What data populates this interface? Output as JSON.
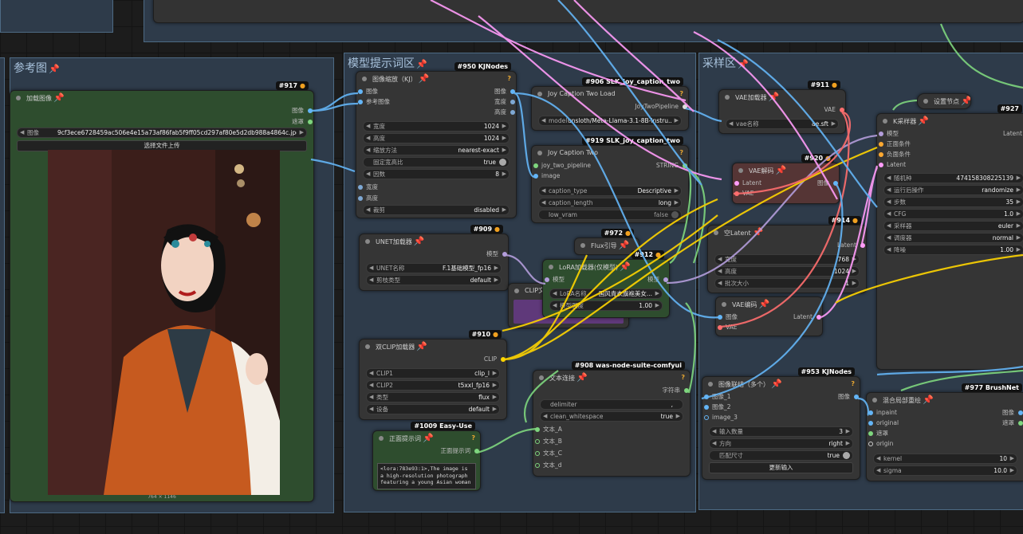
{
  "groups": {
    "reference": {
      "title": "参考图"
    },
    "prompt": {
      "title": "模型提示词区"
    },
    "sampler": {
      "title": "采样区"
    }
  },
  "nodes": {
    "load_image": {
      "badge": "#917",
      "title": "加载图像",
      "outputs": [
        "图像",
        "遮罩"
      ],
      "image_name_label": "图像",
      "image_name_value": "9cf3ece6728459ac506e4e15a73af86fab5f9ff05cd297af80e5d2db988a4864c.jpg",
      "upload_label": "选择文件上传",
      "image_size": "764 × 1146"
    },
    "image_scale": {
      "badge": "#950 KJNodes",
      "title": "图像缩放（KJ）",
      "inputs": [
        "图像",
        "参考图像"
      ],
      "outputs": [
        "图像",
        "宽度",
        "高度"
      ],
      "widgets": [
        {
          "label": "宽度",
          "value": "1024"
        },
        {
          "label": "高度",
          "value": "1024"
        },
        {
          "label": "缩放方法",
          "value": "nearest-exact"
        },
        {
          "label": "固定宽高比",
          "value": "true"
        },
        {
          "label": "因数",
          "value": "8"
        }
      ],
      "extra_inputs": [
        "宽度",
        "高度"
      ],
      "crop": {
        "label": "裁剪",
        "value": "disabled"
      }
    },
    "joy_load": {
      "badge": "#906 SLK_joy_caption_two",
      "title": "Joy Caption Two Load",
      "output": "JoyTwoPipeline",
      "model": {
        "label": "model",
        "value": "unsloth/Meta-Llama-3.1-8B-Instru..."
      }
    },
    "joy_two": {
      "badge": "#919 SLK_joy_caption_two",
      "title": "Joy Caption Two",
      "inputs": [
        "joy_two_pipeline",
        "image"
      ],
      "output": "STRING",
      "widgets": [
        {
          "label": "caption_type",
          "value": "Descriptive"
        },
        {
          "label": "caption_length",
          "value": "long"
        },
        {
          "label": "low_vram",
          "value": "false"
        }
      ]
    },
    "unet": {
      "badge": "#909",
      "title": "UNET加载器",
      "output": "模型",
      "widgets": [
        {
          "label": "UNET名称",
          "value": "F.1基础模型_fp16"
        },
        {
          "label": "剪枝类型",
          "value": "default"
        }
      ]
    },
    "flux_guide": {
      "badge": "#972",
      "title": "Flux引导"
    },
    "lora": {
      "badge": "#912",
      "title": "LoRA加载器(仅模型)",
      "input": "模型",
      "output": "模型",
      "widgets": [
        {
          "label": "LoRA名称",
          "value": "国风青衣旗袍美女..."
        },
        {
          "label": "模型强度",
          "value": "1.00"
        }
      ]
    },
    "dual_clip": {
      "badge": "#910",
      "title": "双CLIP加载器",
      "output": "CLIP",
      "widgets": [
        {
          "label": "CLIP1",
          "value": "clip_l"
        },
        {
          "label": "CLIP2",
          "value": "t5xxl_fp16"
        },
        {
          "label": "类型",
          "value": "flux"
        },
        {
          "label": "设备",
          "value": "default"
        }
      ]
    },
    "clip_hidden": {
      "title": "CLIP文"
    },
    "text_concat": {
      "badge": "#908 was-node-suite-comfyui",
      "title": "文本连接",
      "output": "字符串",
      "widgets": [
        {
          "label": "delimiter",
          "value": ","
        },
        {
          "label": "clean_whitespace",
          "value": "true"
        }
      ],
      "inputs": [
        "文本_A",
        "文本_B",
        "文本_C",
        "文本_d"
      ]
    },
    "pos_prompt": {
      "badge": "#1009 Easy-Use",
      "title": "正面提示词",
      "output": "正面提示词",
      "text": "<lora:783e93:1>,The image is a high-resolution photograph featuring a young Asian woman"
    },
    "vae_loader": {
      "badge": "#911",
      "title": "VAE加载器",
      "output": "VAE",
      "widget": {
        "label": "vae名称",
        "value": "ae.sft"
      }
    },
    "vae_decode": {
      "badge": "#920",
      "title": "VAE解码",
      "inputs": [
        "Latent",
        "VAE"
      ],
      "output": "图像"
    },
    "empty_latent": {
      "badge": "#914",
      "title": "空Latent",
      "output": "Latent",
      "widgets": [
        {
          "label": "宽度",
          "value": "768"
        },
        {
          "label": "高度",
          "value": "1024"
        },
        {
          "label": "批次大小",
          "value": "1"
        }
      ]
    },
    "vae_encode": {
      "title": "VAE编码",
      "inputs": [
        "图像",
        "VAE"
      ],
      "output": "Latent"
    },
    "set_node": {
      "title": "设置节点"
    },
    "ksampler": {
      "badge": "#927",
      "title": "K采样器",
      "inputs": [
        "模型",
        "正面条件",
        "负面条件",
        "Latent"
      ],
      "output": "Latent",
      "widgets": [
        {
          "label": "随机种",
          "value": "474158308225139"
        },
        {
          "label": "运行后操作",
          "value": "randomize"
        },
        {
          "label": "步数",
          "value": "35"
        },
        {
          "label": "CFG",
          "value": "1.0"
        },
        {
          "label": "采样器",
          "value": "euler"
        },
        {
          "label": "调度器",
          "value": "normal"
        },
        {
          "label": "降噪",
          "value": "1.00"
        }
      ]
    },
    "image_stitch": {
      "badge": "#953 KJNodes",
      "title": "图像联结（多个）",
      "output": "图像",
      "inputs": [
        "图像_1",
        "图像_2",
        "image_3"
      ],
      "widgets": [
        {
          "label": "输入数量",
          "value": "3"
        },
        {
          "label": "方向",
          "value": "right"
        },
        {
          "label": "匹配尺寸",
          "value": "true"
        }
      ],
      "button": "更新输入"
    },
    "brushnet": {
      "badge": "#977 BrushNet",
      "title": "混合局部重绘",
      "inputs": [
        "inpaint",
        "original",
        "遮罩",
        "origin"
      ],
      "outputs": [
        "图像",
        "遮罩"
      ],
      "widgets": [
        {
          "label": "kernel",
          "value": "10"
        },
        {
          "label": "sigma",
          "value": "10.0"
        }
      ]
    }
  },
  "colors": {
    "group_bg": "#2e3b4a",
    "node_bg": "#353535",
    "green_node": "#2e4d2e",
    "wire_model": "#b39ddb",
    "wire_clip": "#ffd500",
    "wire_image": "#64b5f6",
    "wire_latent": "#ff9cf9",
    "wire_vae": "#ff6e6e",
    "wire_string": "#77dd55"
  }
}
